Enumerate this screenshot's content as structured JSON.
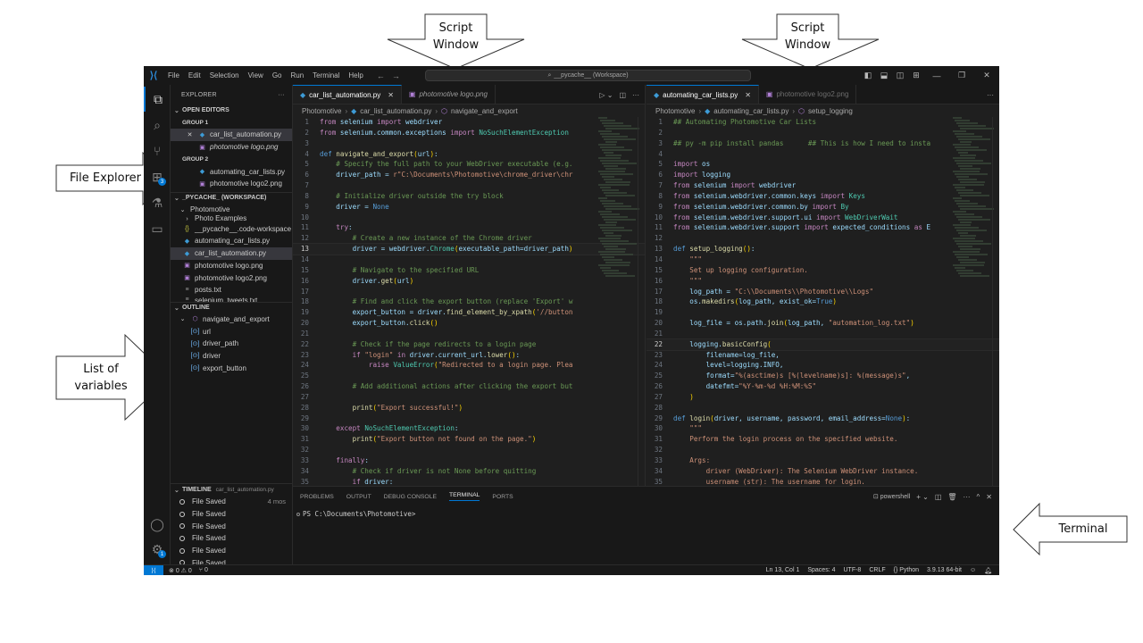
{
  "annotations": {
    "script_window_left": [
      "Script",
      "Window"
    ],
    "script_window_right": [
      "Script",
      "Window"
    ],
    "file_explorer": "File Explorer",
    "list_of_variables": [
      "List of",
      "variables"
    ],
    "terminal": "Terminal"
  },
  "titlebar": {
    "menu": [
      "File",
      "Edit",
      "Selection",
      "View",
      "Go",
      "Run",
      "Terminal",
      "Help"
    ],
    "search_text": "__pycache__ (Workspace)",
    "back_icon": "←",
    "forward_icon": "→"
  },
  "activity_bar": {
    "items": [
      "explorer",
      "search",
      "source-control",
      "extensions",
      "testing",
      "remote-explorer"
    ],
    "extensions_badge": "3",
    "settings_badge": "1"
  },
  "sidebar": {
    "title": "EXPLORER",
    "more": "···",
    "open_editors": {
      "header": "OPEN EDITORS",
      "groups": [
        {
          "label": "GROUP 1",
          "files": [
            {
              "name": "car_list_automation.py",
              "type": "py",
              "active": true
            },
            {
              "name": "photomotive logo.png",
              "type": "png",
              "preview": true
            }
          ]
        },
        {
          "label": "GROUP 2",
          "files": [
            {
              "name": "automating_car_lists.py",
              "type": "py"
            },
            {
              "name": "photomotive logo2.png",
              "type": "png"
            }
          ]
        }
      ]
    },
    "workspace": {
      "header": "_PYCACHE_ (WORKSPACE)",
      "folder": "Photomotive",
      "items": [
        {
          "name": "Photo Examples",
          "type": "folder"
        },
        {
          "name": "__pycache__.code-workspace",
          "type": "json"
        },
        {
          "name": "automating_car_lists.py",
          "type": "py"
        },
        {
          "name": "car_list_automation.py",
          "type": "py",
          "selected": true
        },
        {
          "name": "photomotive logo.png",
          "type": "png"
        },
        {
          "name": "photomotive logo2.png",
          "type": "png"
        },
        {
          "name": "posts.txt",
          "type": "txt"
        },
        {
          "name": "selenium_tweets.txt",
          "type": "txt"
        }
      ]
    },
    "outline": {
      "header": "OUTLINE",
      "function": "navigate_and_export",
      "variables": [
        "url",
        "driver_path",
        "driver",
        "export_button"
      ]
    },
    "timeline": {
      "header": "TIMELINE",
      "file": "car_list_automation.py",
      "entries": [
        {
          "label": "File Saved",
          "when": "4 mos"
        },
        {
          "label": "File Saved",
          "when": ""
        },
        {
          "label": "File Saved",
          "when": ""
        },
        {
          "label": "File Saved",
          "when": ""
        },
        {
          "label": "File Saved",
          "when": ""
        },
        {
          "label": "File Saved",
          "when": ""
        }
      ]
    }
  },
  "editor_left": {
    "tabs": [
      {
        "label": "car_list_automation.py",
        "type": "py",
        "active": true
      },
      {
        "label": "photomotive logo.png",
        "type": "png",
        "preview": true
      }
    ],
    "breadcrumb": [
      "Photomotive",
      "car_list_automation.py",
      "navigate_and_export"
    ],
    "current_line": 13,
    "lines": [
      "from selenium import webdriver",
      "from selenium.common.exceptions import NoSuchElementException",
      "",
      "def navigate_and_export(url):",
      "    # Specify the full path to your WebDriver executable (e.g.",
      "    driver_path = r\"C:\\Documents\\Photomotive\\chrome_driver\\chr",
      "",
      "    # Initialize driver outside the try block",
      "    driver = None",
      "",
      "    try:",
      "        # Create a new instance of the Chrome driver",
      "        driver = webdriver.Chrome(executable_path=driver_path)",
      "",
      "        # Navigate to the specified URL",
      "        driver.get(url)",
      "",
      "        # Find and click the export button (replace 'Export' w",
      "        export_button = driver.find_element_by_xpath('//button",
      "        export_button.click()",
      "",
      "        # Check if the page redirects to a login page",
      "        if \"login\" in driver.current_url.lower():",
      "            raise ValueError(\"Redirected to a login page. Plea",
      "",
      "        # Add additional actions after clicking the export but",
      "",
      "        print(\"Export successful!\")",
      "",
      "    except NoSuchElementException:",
      "        print(\"Export button not found on the page.\")",
      "",
      "    finally:",
      "        # Check if driver is not None before quitting",
      "        if driver:"
    ]
  },
  "editor_right": {
    "tabs": [
      {
        "label": "automating_car_lists.py",
        "type": "py",
        "active": true
      },
      {
        "label": "photomotive logo2.png",
        "type": "png"
      }
    ],
    "breadcrumb": [
      "Photomotive",
      "automating_car_lists.py",
      "setup_logging"
    ],
    "current_line": 22,
    "lines": [
      "## Automating Photomotive Car Lists",
      "",
      "## py -m pip install pandas      ## This is how I need to insta",
      "",
      "import os",
      "import logging",
      "from selenium import webdriver",
      "from selenium.webdriver.common.keys import Keys",
      "from selenium.webdriver.common.by import By",
      "from selenium.webdriver.support.ui import WebDriverWait",
      "from selenium.webdriver.support import expected_conditions as E",
      "",
      "def setup_logging():",
      "    \"\"\"",
      "    Set up logging configuration.",
      "    \"\"\"",
      "    log_path = \"C:\\\\Documents\\\\Photomotive\\\\Logs\"",
      "    os.makedirs(log_path, exist_ok=True)",
      "",
      "    log_file = os.path.join(log_path, \"automation_log.txt\")",
      "",
      "    logging.basicConfig(",
      "        filename=log_file,",
      "        level=logging.INFO,",
      "        format=\"%(asctime)s [%(levelname)s]: %(message)s\",",
      "        datefmt=\"%Y-%m-%d %H:%M:%S\"",
      "    )",
      "",
      "def login(driver, username, password, email_address=None):",
      "    \"\"\"",
      "    Perform the login process on the specified website.",
      "",
      "    Args:",
      "        driver (WebDriver): The Selenium WebDriver instance.",
      "        username (str): The username for login."
    ]
  },
  "panel": {
    "tabs": [
      "PROBLEMS",
      "OUTPUT",
      "DEBUG CONSOLE",
      "TERMINAL",
      "PORTS"
    ],
    "active_tab": "TERMINAL",
    "shell": "powershell",
    "prompt": "PS C:\\Documents\\Photomotive>"
  },
  "statusbar": {
    "errors": "0",
    "warnings": "0",
    "ports": "0",
    "position": "Ln 13, Col 1",
    "spaces": "Spaces: 4",
    "encoding": "UTF-8",
    "eol": "CRLF",
    "language": "Python",
    "interpreter": "3.9.13 64-bit"
  },
  "colors": {
    "accent": "#0078d4",
    "background": "#1f1f1f",
    "sidebar": "#181818"
  }
}
